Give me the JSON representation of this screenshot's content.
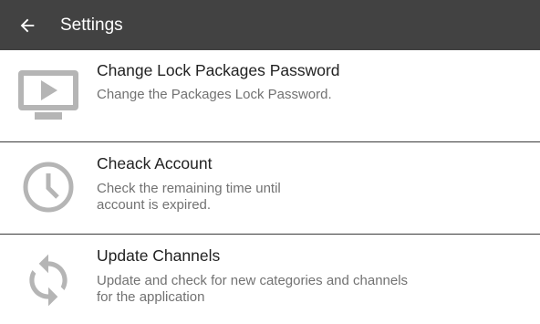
{
  "appbar": {
    "title": "Settings",
    "back_icon": "arrow-back-icon"
  },
  "settings": {
    "items": [
      {
        "title": "Change Lock Packages Password",
        "subtitle": "Change the Packages Lock Password.",
        "icon": "tv-play-icon"
      },
      {
        "title": "Cheack Account",
        "subtitle": "Check the remaining time until\naccount is expired.",
        "icon": "clock-icon"
      },
      {
        "title": "Update Channels",
        "subtitle": "Update and check for new categories and channels\nfor the application",
        "icon": "sync-icon"
      }
    ]
  },
  "colors": {
    "appbar_bg": "#424242",
    "icon_gray": "#b5b5b5",
    "divider": "#3a3a3a"
  }
}
